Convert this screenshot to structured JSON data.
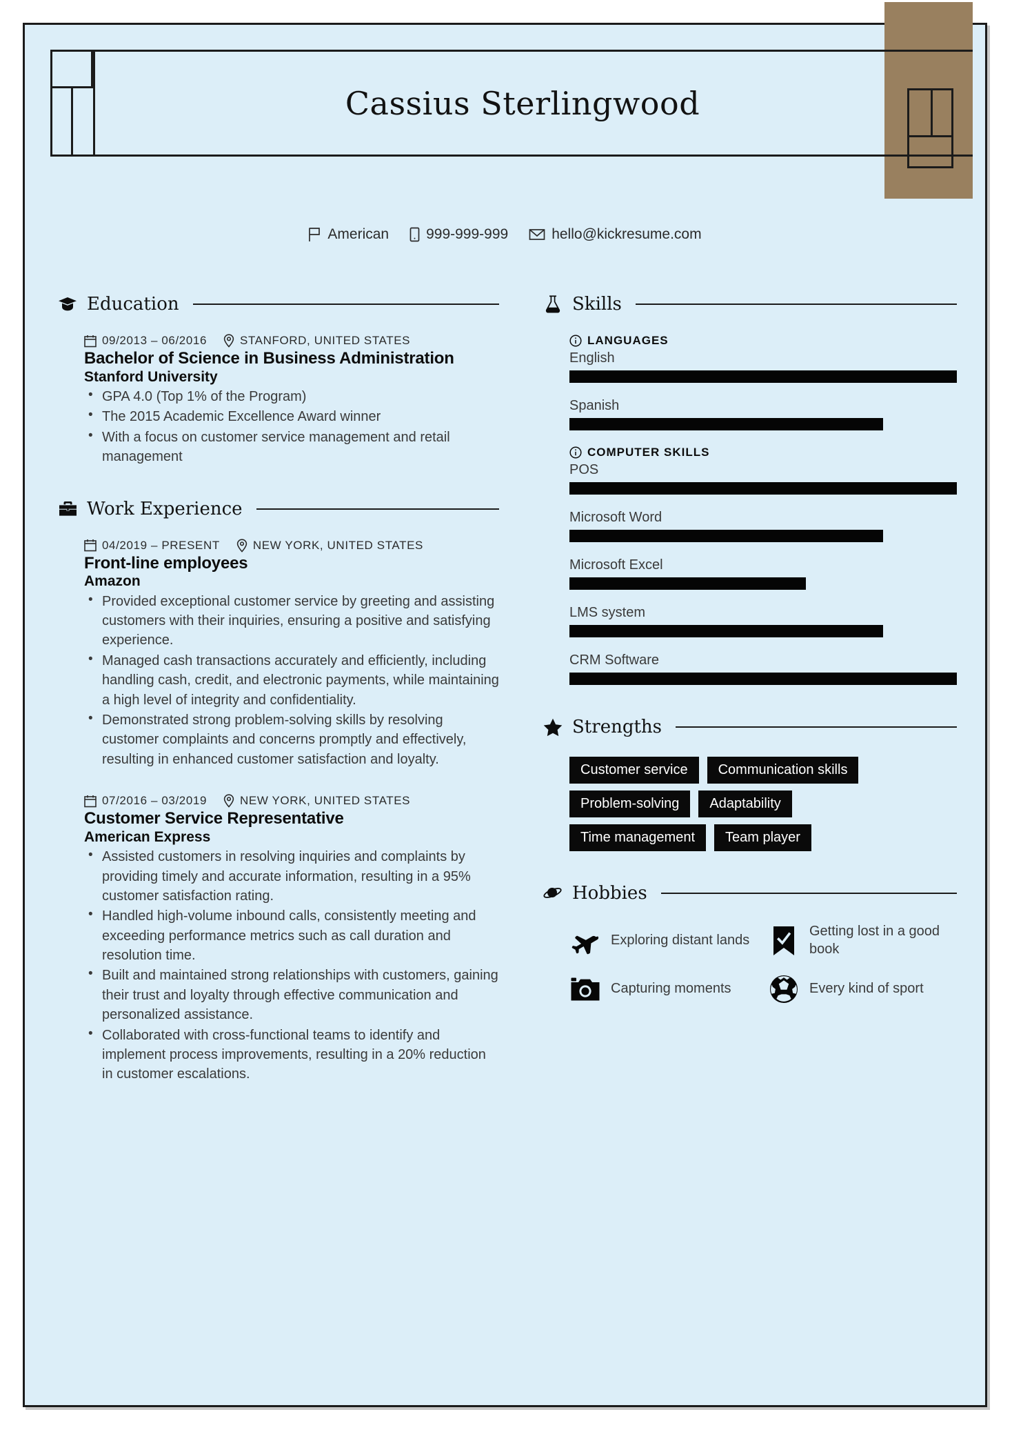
{
  "theme": {
    "page_background": "#dceef8",
    "accent_block": "#99805f",
    "ink": "#0d0d0d",
    "body_text": "#3a3a3a",
    "bar_fill": "#050505",
    "tag_background": "#0a0a0a",
    "tag_text": "#ffffff"
  },
  "header": {
    "name": "Cassius Sterlingwood"
  },
  "contact": [
    {
      "icon": "flag-icon",
      "value": "American"
    },
    {
      "icon": "phone-icon",
      "value": "999-999-999"
    },
    {
      "icon": "envelope-icon",
      "value": "hello@kickresume.com"
    }
  ],
  "education": {
    "icon": "graduation-cap-icon",
    "title": "Education",
    "entries": [
      {
        "date": "09/2013 – 06/2016",
        "location": "STANFORD, UNITED STATES",
        "title": "Bachelor of Science in Business Administration",
        "organization": "Stanford University",
        "bullets": [
          "GPA 4.0 (Top 1% of the Program)",
          "The 2015 Academic Excellence Award winner",
          "With a focus on customer service management and retail management"
        ]
      }
    ]
  },
  "work_experience": {
    "icon": "briefcase-icon",
    "title": "Work Experience",
    "entries": [
      {
        "date": "04/2019 – PRESENT",
        "location": "NEW YORK, UNITED STATES",
        "title": "Front-line employees",
        "organization": "Amazon",
        "bullets": [
          "Provided exceptional customer service by greeting and assisting customers with their inquiries, ensuring a positive and satisfying experience.",
          "Managed cash transactions accurately and efficiently, including handling cash, credit, and electronic payments, while maintaining a high level of integrity and confidentiality.",
          "Demonstrated strong problem-solving skills by resolving customer complaints and concerns promptly and effectively, resulting in enhanced customer satisfaction and loyalty."
        ]
      },
      {
        "date": "07/2016 – 03/2019",
        "location": "NEW YORK, UNITED STATES",
        "title": "Customer Service Representative",
        "organization": "American Express",
        "bullets": [
          "Assisted customers in resolving inquiries and complaints by providing timely and accurate information, resulting in a 95% customer satisfaction rating.",
          "Handled high-volume inbound calls, consistently meeting and exceeding performance metrics such as call duration and resolution time.",
          "Built and maintained strong relationships with customers, gaining their trust and loyalty through effective communication and personalized assistance.",
          "Collaborated with cross-functional teams to identify and implement process improvements, resulting in a 20% reduction in customer escalations."
        ]
      }
    ]
  },
  "skills": {
    "icon": "flask-icon",
    "title": "Skills",
    "groups": [
      {
        "icon": "info-icon",
        "label": "LANGUAGES",
        "items": [
          {
            "name": "English",
            "level": 100
          },
          {
            "name": "Spanish",
            "level": 81
          }
        ]
      },
      {
        "icon": "info-icon",
        "label": "COMPUTER SKILLS",
        "items": [
          {
            "name": "POS",
            "level": 100
          },
          {
            "name": "Microsoft Word",
            "level": 81
          },
          {
            "name": "Microsoft Excel",
            "level": 61
          },
          {
            "name": "LMS system",
            "level": 81
          },
          {
            "name": "CRM Software",
            "level": 100
          }
        ]
      }
    ]
  },
  "strengths": {
    "icon": "star-icon",
    "title": "Strengths",
    "tags": [
      "Customer service",
      "Communication skills",
      "Problem-solving",
      "Adaptability",
      "Time management",
      "Team player"
    ]
  },
  "hobbies": {
    "icon": "planet-icon",
    "title": "Hobbies",
    "items": [
      {
        "icon": "airplane-icon",
        "label": "Exploring distant lands"
      },
      {
        "icon": "bookmark-check-icon",
        "label": "Getting lost in a good book"
      },
      {
        "icon": "camera-icon",
        "label": "Capturing moments"
      },
      {
        "icon": "soccer-ball-icon",
        "label": "Every kind of sport"
      }
    ]
  }
}
